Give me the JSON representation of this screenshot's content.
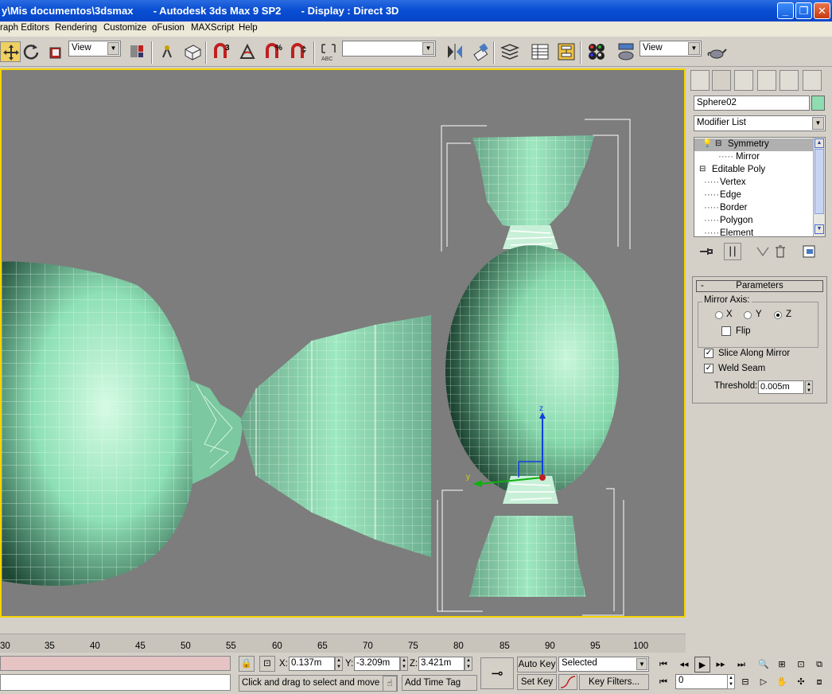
{
  "window": {
    "title": "y\\Mis documentos\\3dsmax       - Autodesk 3ds Max 9 SP2       - Display : Direct 3D"
  },
  "menu": [
    "raph Editors",
    "Rendering",
    "Customize",
    "oFusion",
    "MAXScript",
    "Help"
  ],
  "toolbar": {
    "ref_coord": "View",
    "named_sel": "",
    "render_view": "View"
  },
  "viewport": {
    "gizmo_labels": {
      "z": "z",
      "y": "y"
    }
  },
  "command_panel": {
    "object_name": "Sphere02",
    "object_color": "#8fdcb0",
    "modifier_list": "Modifier List",
    "stack": [
      {
        "label": "Symmetry",
        "selected": true
      },
      {
        "label": "Mirror"
      },
      {
        "label": "Editable Poly"
      },
      {
        "label": "Vertex"
      },
      {
        "label": "Edge"
      },
      {
        "label": "Border"
      },
      {
        "label": "Polygon"
      },
      {
        "label": "Element"
      }
    ],
    "parameters": {
      "title": "Parameters",
      "collapse": "-",
      "mirror_axis_label": "Mirror Axis:",
      "axes": [
        {
          "label": "X",
          "checked": false
        },
        {
          "label": "Y",
          "checked": false
        },
        {
          "label": "Z",
          "checked": true
        }
      ],
      "flip": {
        "label": "Flip",
        "checked": false
      },
      "slice": {
        "label": "Slice Along Mirror",
        "checked": true
      },
      "weld": {
        "label": "Weld Seam",
        "checked": true
      },
      "threshold_label": "Threshold:",
      "threshold_value": "0.005m"
    }
  },
  "timeline": {
    "ticks": [
      "30",
      "35",
      "40",
      "45",
      "50",
      "55",
      "60",
      "65",
      "70",
      "75",
      "80",
      "85",
      "90",
      "95",
      "100"
    ]
  },
  "status": {
    "prompt": "Click and drag to select and move o",
    "add_time_tag": "Add Time Tag",
    "x_label": "X:",
    "x": "0.137m",
    "y_label": "Y:",
    "y": "-3.209m",
    "z_label": "Z:",
    "z": "3.421m",
    "auto_key": "Auto Key",
    "set_key": "Set Key",
    "key_mode": "Selected",
    "key_filters": "Key Filters...",
    "frame": "0"
  }
}
